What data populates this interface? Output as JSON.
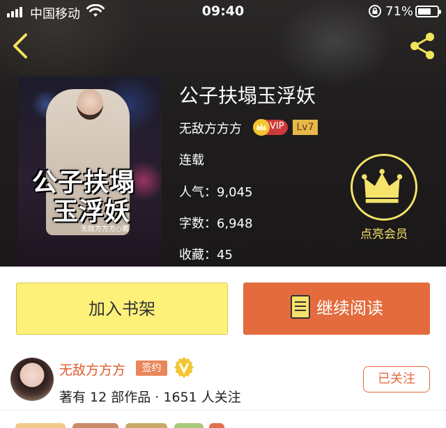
{
  "status_bar": {
    "carrier": "中国移动",
    "time": "09:40",
    "battery": "71%",
    "battery_level": 0.71
  },
  "book": {
    "title": "公子扶塌玉浮妖",
    "author": "无敌方方方",
    "vip_label": "VIP",
    "level": "Lv7",
    "status": "连载",
    "popularity_label": "人气：",
    "popularity": "9,045",
    "words_label": "字数：",
    "words": "6,948",
    "favorites_label": "收藏：",
    "favorites": "45",
    "cover_title_line1": "公子扶塌",
    "cover_title_line2": "玉浮妖",
    "cover_author": "无敌方方方○著",
    "vip_action": "点亮会员"
  },
  "actions": {
    "add_shelf": "加入书架",
    "continue_reading": "继续阅读"
  },
  "author_card": {
    "name": "无敌方方方",
    "sign_badge": "签约",
    "stats": "著有 12 部作品 · 1651 人关注",
    "follow_label": "已关注"
  },
  "colors": {
    "accent_yellow": "#f5e36a",
    "accent_orange": "#e36b3d",
    "shelf_button": "#fdf17a"
  },
  "icons": [
    "back-icon",
    "share-icon",
    "crown-icon",
    "book-icon",
    "v-badge-icon"
  ]
}
